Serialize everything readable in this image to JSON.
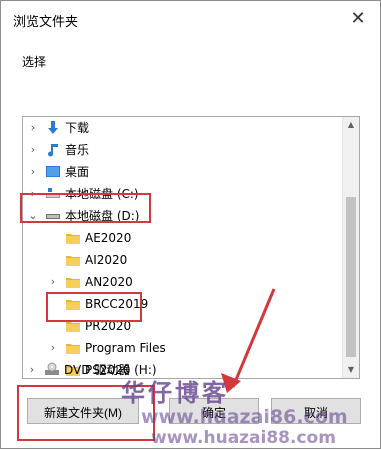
{
  "dialog": {
    "title": "浏览文件夹",
    "prompt": "选择"
  },
  "tree": {
    "items": [
      {
        "label": "下载",
        "icon": "download-icon",
        "expandable": true,
        "expanded": false
      },
      {
        "label": "音乐",
        "icon": "music-icon",
        "expandable": true,
        "expanded": false
      },
      {
        "label": "桌面",
        "icon": "desktop-icon",
        "expandable": true,
        "expanded": false
      },
      {
        "label": "本地磁盘 (C:)",
        "icon": "drive-icon",
        "expandable": true,
        "expanded": false
      },
      {
        "label": "本地磁盘 (D:)",
        "icon": "drive-icon",
        "expandable": true,
        "expanded": true
      },
      {
        "label": "AE2020",
        "icon": "folder-icon",
        "expandable": false
      },
      {
        "label": "AI2020",
        "icon": "folder-icon",
        "expandable": false
      },
      {
        "label": "AN2020",
        "icon": "folder-icon",
        "expandable": true,
        "expanded": false
      },
      {
        "label": "BRCC2019",
        "icon": "folder-icon",
        "expandable": false
      },
      {
        "label": "PR2020",
        "icon": "folder-icon",
        "expandable": false,
        "selected": true
      },
      {
        "label": "Program Files",
        "icon": "folder-icon",
        "expandable": true,
        "expanded": false
      },
      {
        "label": "PS2020",
        "icon": "folder-icon",
        "expandable": true,
        "expanded": false
      },
      {
        "label": "DVD 驱动器 (H:)",
        "icon": "dvd-icon",
        "expandable": true,
        "expanded": false
      }
    ]
  },
  "buttons": {
    "new_folder": "新建文件夹(M)",
    "ok": "确定",
    "cancel": "取消"
  },
  "watermark": {
    "brand": "华仔博客",
    "url1": "www.huazai86.com",
    "url2": "www.huazai88.com"
  },
  "colors": {
    "highlight": "#d3383c",
    "folder": "#f6cf5a",
    "download_arrow": "#2a7bd4",
    "desktop": "#2a7bd4"
  }
}
